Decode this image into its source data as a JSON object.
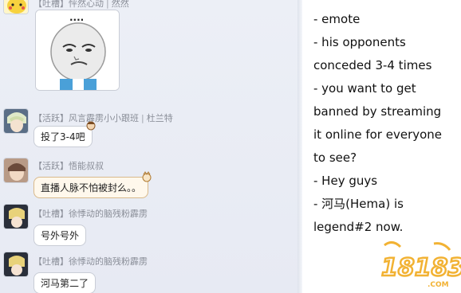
{
  "chat": {
    "messages": [
      {
        "tag": "【吐槽】",
        "name": "怦然心动",
        "extra": "然然",
        "text": ""
      },
      {
        "tag": "【活跃】",
        "name": "风言霹雳小小跟班",
        "extra": "杜兰特",
        "text": "投了3-4吧"
      },
      {
        "tag": "【活跃】",
        "name": "悟能叔叔",
        "extra": "",
        "text": "直播人脉不怕被封么。。"
      },
      {
        "tag": "【吐槽】",
        "name": "徐悸动的脑残粉霹雳",
        "extra": "",
        "text": "号外号外"
      },
      {
        "tag": "【吐槽】",
        "name": "徐悸动的脑残粉霹雳",
        "extra": "",
        "text": "河马第二了"
      }
    ],
    "separator": "|",
    "meme_dots": "....",
    "meme_icon": "rage-face-meme-icon"
  },
  "translation": {
    "lines": [
      "- emote",
      "- his opponents",
      "conceded 3-4 times",
      "- you want to get",
      "banned by streaming",
      "it online for everyone",
      "to see?",
      "- Hey guys",
      "- 河马(Hema) is",
      "legend#2 now."
    ]
  },
  "watermark": {
    "text": "18183",
    "sub": ".COM",
    "color": "#f2b233"
  },
  "colors": {
    "panel": "#eceff6",
    "bubble_border": "#c9cdd6",
    "warm_bubble": "#fff8ec"
  }
}
